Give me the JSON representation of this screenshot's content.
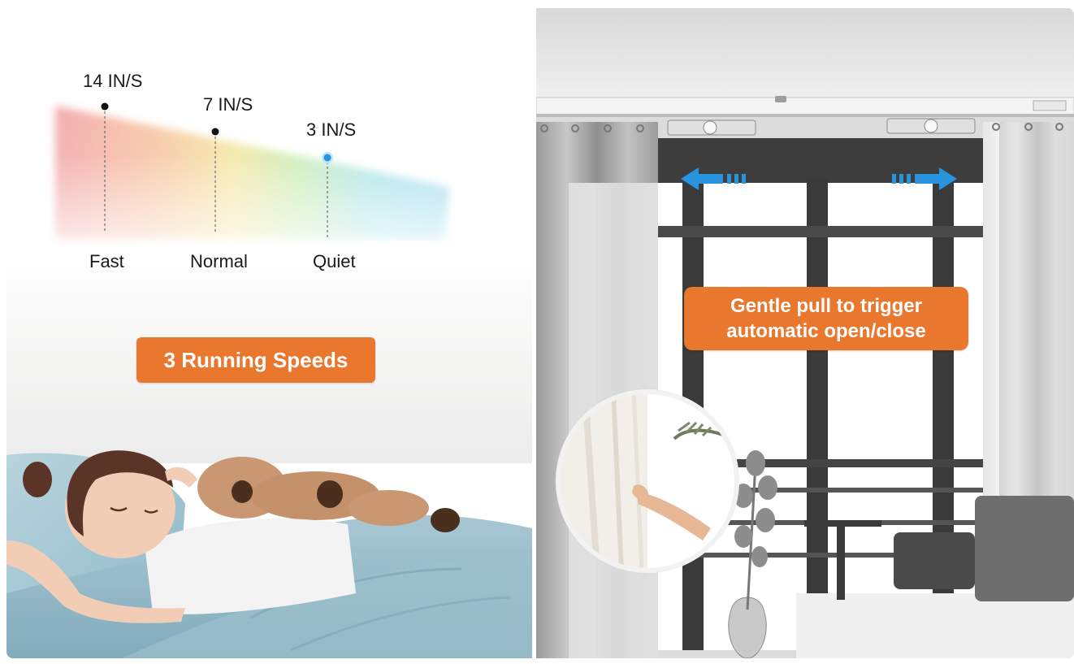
{
  "speeds": {
    "fast_value": "14 IN/S",
    "normal_value": "7 IN/S",
    "quiet_value": "3 IN/S",
    "fast_label": "Fast",
    "normal_label": "Normal",
    "quiet_label": "Quiet"
  },
  "left_badge": "3 Running Speeds",
  "right_badge": {
    "line1": "Gentle pull to trigger",
    "line2": "automatic open/close"
  },
  "colors": {
    "badge": "#e9772e",
    "arrow": "#2a93e0",
    "quiet_dot": "#2a93e0"
  }
}
